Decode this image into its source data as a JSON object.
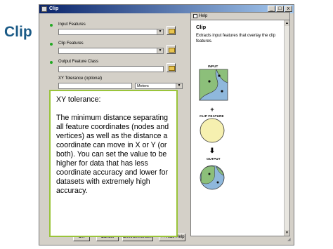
{
  "slide": {
    "title": "Clip"
  },
  "window": {
    "title": "Clip",
    "controls": {
      "minimize": "_",
      "maximize": "□",
      "close": "x"
    }
  },
  "form": {
    "input_features": {
      "label": "Input Features",
      "value": ""
    },
    "clip_features": {
      "label": "Clip Features",
      "value": ""
    },
    "output_feature_class": {
      "label": "Output Feature Class",
      "value": ""
    },
    "xy_tolerance": {
      "label": "XY Tolerance (optional)",
      "value": "",
      "units": "Meters"
    }
  },
  "tooltip": {
    "title": "XY tolerance:",
    "body": "The minimum distance separating all feature coordinates (nodes and vertices) as well as the distance a coordinate can move in X or Y (or both). You can set the value to be higher for data that has less coordinate accuracy and lower for datasets with extremely high accuracy."
  },
  "help": {
    "tab_label": "Help",
    "heading": "Clip",
    "description": "Extracts input features that overlay the clip features.",
    "diagram": {
      "input_label": "INPUT",
      "clip_label": "CLIP FEATURE",
      "output_label": "OUTPUT",
      "colors": {
        "input_blue": "#8fb8dc",
        "input_green": "#8cbf7a",
        "clip_fill": "#f6f0b0",
        "output_blue": "#8fb8dc"
      }
    }
  },
  "buttons": {
    "ok": "OK",
    "cancel": "Cancel",
    "environments": "Environments...",
    "hide_help": "<< Hide Help"
  }
}
